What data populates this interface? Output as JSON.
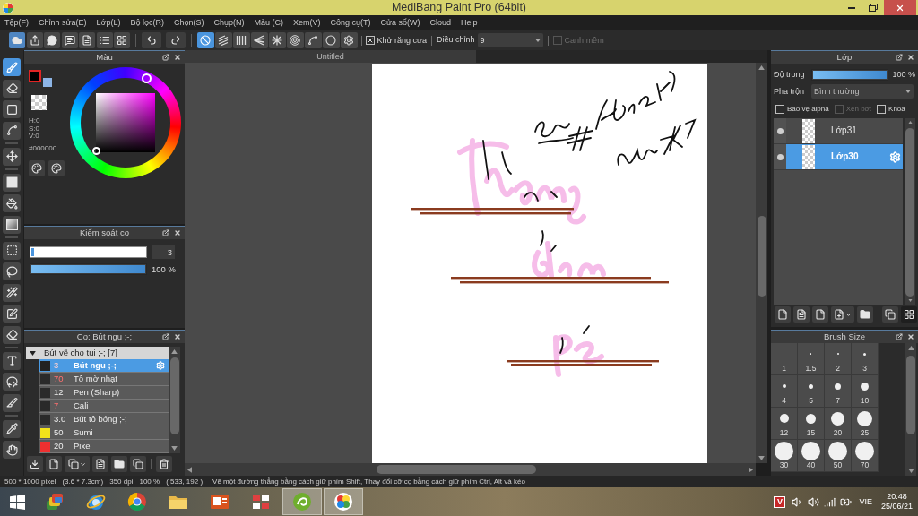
{
  "window": {
    "title": "MediBang Paint Pro (64bit)"
  },
  "menu": [
    "Tệp(F)",
    "Chỉnh sửa(E)",
    "Lớp(L)",
    "Bộ lọc(R)",
    "Chọn(S)",
    "Chụp(N)",
    "Màu (C)",
    "Xem(V)",
    "Công cụ(T)",
    "Cửa sổ(W)",
    "Cloud",
    "Help"
  ],
  "toolbar": {
    "rulers": [
      {
        "kind": "none",
        "selected": true
      },
      {
        "kind": "parallel",
        "selected": false
      },
      {
        "kind": "vertical",
        "selected": false
      },
      {
        "kind": "perspective",
        "selected": false
      },
      {
        "kind": "radial",
        "selected": false
      },
      {
        "kind": "concentric",
        "selected": false
      },
      {
        "kind": "curve",
        "selected": false
      },
      {
        "kind": "ellipse",
        "selected": false
      },
      {
        "kind": "settings",
        "selected": false
      }
    ],
    "antialias": {
      "label": "Khử răng cưa",
      "checked": true
    },
    "correction": {
      "label": "Điều chỉnh",
      "value": "9"
    },
    "soft_edge": {
      "label": "Canh mềm",
      "checked": false,
      "disabled": true
    }
  },
  "tool_groups": [
    [
      {
        "kind": "brush",
        "selected": true
      },
      {
        "kind": "eraser",
        "selected": false
      },
      {
        "kind": "shape",
        "selected": false
      },
      {
        "kind": "figure",
        "selected": false
      }
    ],
    [
      {
        "kind": "move",
        "selected": false
      }
    ],
    [
      {
        "kind": "fill",
        "selected": false
      },
      {
        "kind": "bucket",
        "selected": false
      },
      {
        "kind": "gradient",
        "selected": false
      }
    ],
    [
      {
        "kind": "select",
        "selected": false
      },
      {
        "kind": "lasso",
        "selected": false
      },
      {
        "kind": "wand",
        "selected": false
      },
      {
        "kind": "select_pen",
        "selected": false
      },
      {
        "kind": "select_eraser",
        "selected": false
      }
    ],
    [
      {
        "kind": "text",
        "selected": false
      },
      {
        "kind": "operation",
        "selected": false
      },
      {
        "kind": "divide",
        "selected": false
      }
    ],
    [
      {
        "kind": "eyedropper",
        "selected": false
      },
      {
        "kind": "hand",
        "selected": false
      }
    ]
  ],
  "color_panel": {
    "title": "Màu",
    "swatches": [
      {
        "color": "#000000",
        "selected": true
      },
      {
        "color": "#8db5e6",
        "selected": false
      }
    ],
    "hsv": [
      "H:0",
      "S:0",
      "V:0"
    ],
    "hex": "#000000"
  },
  "brush_control": {
    "title": "Kiểm soát cọ",
    "size": {
      "level": 0.02,
      "value": "3"
    },
    "opacity": {
      "level": 1,
      "reading": "100 %"
    }
  },
  "brush_panel": {
    "title": "Cọ: Bút ngu ;-;",
    "groups": [
      {
        "name": "Bút vẽ cho tui ;-; [7]",
        "expanded": true,
        "children": [
          {
            "size": "3",
            "size_highlighted": true,
            "name": "Bút ngu ;-;",
            "color": "#222222",
            "selected": true
          },
          {
            "size": "70",
            "size_highlighted": true,
            "name": "Tô mờ nhạt",
            "color": "#2a2a2a",
            "selected": false
          },
          {
            "size": "12",
            "size_highlighted": false,
            "name": "Pen (Sharp)",
            "color": "#2a2a2a",
            "selected": false
          },
          {
            "size": "7",
            "size_highlighted": true,
            "name": "Cali",
            "color": "#2a2a2a",
            "selected": false
          },
          {
            "size": "3.0",
            "size_highlighted": false,
            "name": "Bút tô bóng ;-;",
            "color": "#2a2a2a",
            "selected": false
          },
          {
            "size": "50",
            "size_highlighted": false,
            "name": "Sumi",
            "color": "#f2e21a",
            "selected": false
          },
          {
            "size": "20",
            "size_highlighted": false,
            "name": "Pixel",
            "color": "#ee3030",
            "selected": false
          }
        ]
      }
    ]
  },
  "canvas": {
    "tab": "Untitled"
  },
  "layer_panel": {
    "title": "Lớp",
    "opacity": {
      "label": "Độ trong",
      "level": 1,
      "reading": "100 %"
    },
    "blend": {
      "label": "Pha trộn",
      "value": "Bình thường"
    },
    "options": [
      {
        "label": "Bảo vệ alpha",
        "checked": false,
        "disabled": false
      },
      {
        "label": "Xén bớt",
        "checked": false,
        "disabled": true
      },
      {
        "label": "Khóa",
        "checked": false,
        "disabled": false
      }
    ],
    "layers": [
      {
        "name": "Lớp31",
        "visible": true,
        "selected": false
      },
      {
        "name": "Lớp30",
        "visible": true,
        "selected": true
      }
    ]
  },
  "brush_size_panel": {
    "title": "Brush Size",
    "sizes": [
      "1",
      "1.5",
      "2",
      "3",
      "4",
      "5",
      "7",
      "10",
      "12",
      "15",
      "20",
      "25",
      "30",
      "40",
      "50",
      "70"
    ]
  },
  "status_bar": {
    "fields": [
      "500 * 1000 pixel",
      "(3.6 * 7.3cm)",
      "350 dpi",
      "100 %",
      "( 533, 192 )"
    ],
    "hint": "Vẽ một đường thẳng bằng cách giữ phím Shift, Thay đổi cỡ cọ bằng cách giữ phím Ctrl, Alt và kéo"
  },
  "taskbar": {
    "apps": [
      {
        "kind": "stack",
        "running": false
      },
      {
        "kind": "orbit",
        "running": false
      },
      {
        "kind": "segments",
        "running": false
      },
      {
        "kind": "folder",
        "running": false
      },
      {
        "kind": "slides",
        "running": false
      },
      {
        "kind": "tiles",
        "running": false
      },
      {
        "kind": "swirl",
        "running": true
      },
      {
        "kind": "petals",
        "running": true
      }
    ],
    "tray": {
      "ime": "V",
      "language": "VIE",
      "time": "20:48",
      "date": "25/06/21"
    }
  }
}
